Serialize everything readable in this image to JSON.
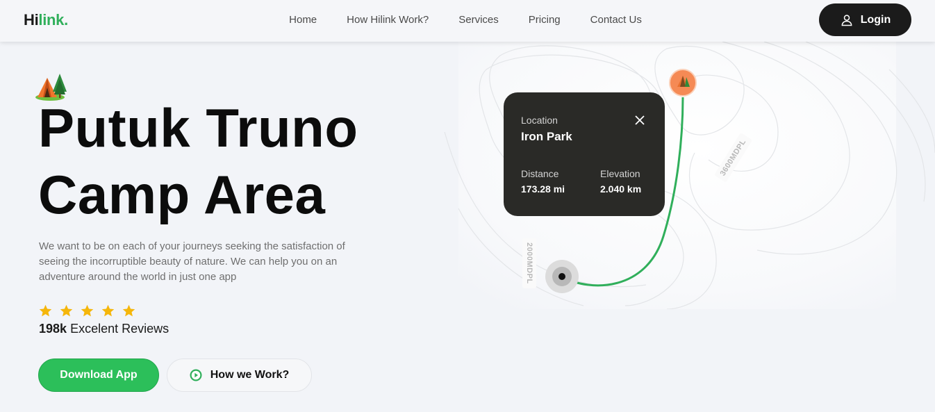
{
  "nav": {
    "logo_prefix": "Hi",
    "logo_suffix": "link.",
    "links": [
      "Home",
      "How Hilink Work?",
      "Services",
      "Pricing",
      "Contact Us"
    ],
    "login_label": "Login"
  },
  "hero": {
    "title_line1": "Putuk Truno",
    "title_line2": "Camp Area",
    "description": "We want to be on each of your journeys seeking the satisfaction of seeing the incorruptible beauty of nature. We can help you on an adventure around the world in just one app",
    "rating_stars": 5,
    "reviews_count": "198k",
    "reviews_label": "Excelent Reviews",
    "download_label": "Download App",
    "how_label": "How we Work?"
  },
  "map": {
    "altitude_low": "2000MDPL",
    "altitude_high": "3600MDPL",
    "card": {
      "location_label": "Location",
      "location_value": "Iron Park",
      "distance_label": "Distance",
      "distance_value": "173.28 mi",
      "elevation_label": "Elevation",
      "elevation_value": "2.040 km"
    }
  },
  "colors": {
    "accent_green": "#30af5b",
    "button_green": "#2cbf5a",
    "dark": "#1b1b1b",
    "star": "#f5b60a",
    "pin_orange": "#f58a55"
  },
  "icons": [
    "user-icon",
    "play-icon",
    "star-icon",
    "close-icon",
    "camp-tent-icon",
    "location-pin-icon",
    "start-point-icon"
  ]
}
